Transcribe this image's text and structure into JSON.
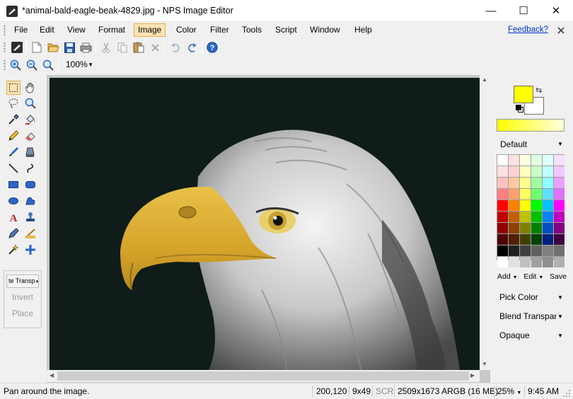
{
  "window": {
    "title": "*animal-bald-eagle-beak-4829.jpg - NPS Image Editor",
    "controls": {
      "minimize": "—",
      "maximize": "☐",
      "close": "✕"
    }
  },
  "menu": {
    "items": [
      "File",
      "Edit",
      "View",
      "Format",
      "Image",
      "Color",
      "Filter",
      "Tools",
      "Script",
      "Window",
      "Help"
    ],
    "active": "Image",
    "feedback": "Feedback?"
  },
  "toolbar": {
    "buttons": [
      "app-icon",
      "new-file-icon",
      "open-folder-icon",
      "save-icon",
      "print-icon",
      "cut-icon",
      "copy-icon",
      "paste-icon",
      "delete-icon",
      "undo-icon",
      "redo-icon",
      "help-icon"
    ],
    "zoom_buttons": [
      "zoom-in-icon",
      "zoom-out-icon",
      "zoom-actual-icon"
    ],
    "zoom_value": "100%"
  },
  "tools": {
    "icons": [
      "rectangle-select-icon",
      "pan-hand-icon",
      "lasso-select-icon",
      "zoom-tool-icon",
      "eyedropper-icon",
      "paint-bucket-icon",
      "pencil-icon",
      "eraser-icon",
      "brush-icon",
      "clone-stamp-icon",
      "line-icon",
      "curve-icon",
      "rectangle-shape-icon",
      "rounded-rectangle-icon",
      "ellipse-shape-icon",
      "freeform-shape-icon",
      "text-tool-icon",
      "stamp-icon",
      "pen-icon",
      "gradient-icon",
      "magic-wand-icon",
      "move-cross-icon"
    ],
    "selected": "rectangle-select-icon",
    "selection_mode": "te Transp",
    "invert_label": "Invert",
    "place_label": "Place"
  },
  "colors": {
    "primary": "#ffff00",
    "secondary": "#ffffff",
    "palette_name": "Default",
    "palette": [
      "#ffffff",
      "#ffe0e0",
      "#ffffe0",
      "#e0ffe0",
      "#e0ffff",
      "#f8e0ff",
      "#ffe0e0",
      "#ffd0d0",
      "#ffffc0",
      "#c8ffc8",
      "#c0ffff",
      "#f0c8ff",
      "#ffc0c0",
      "#ffc8a0",
      "#ffff90",
      "#a0ffa0",
      "#90ffff",
      "#e8a0ff",
      "#ff8080",
      "#ffa070",
      "#ffff60",
      "#70ff70",
      "#60e0ff",
      "#e070ff",
      "#ff0000",
      "#ff8000",
      "#ffff00",
      "#00ff00",
      "#00c0ff",
      "#ff00ff",
      "#c00000",
      "#c06000",
      "#c0c000",
      "#00c000",
      "#0080ff",
      "#c000c0",
      "#900000",
      "#904000",
      "#808000",
      "#008000",
      "#0050c0",
      "#800080",
      "#500000",
      "#502000",
      "#404000",
      "#004000",
      "#002080",
      "#400040",
      "#000000",
      "#202020",
      "#404040",
      "#606060",
      "#808080",
      "#707070",
      "#ffffff",
      "#e0e0e0",
      "#c0c0c0",
      "#a0a0a0",
      "#909090",
      "#b0b0b0"
    ],
    "palette_actions": {
      "add": "Add",
      "edit": "Edit",
      "save": "Save"
    },
    "pick_color": "Pick Color",
    "blend_mode": "Blend Transparency",
    "opacity_mode": "Opaque"
  },
  "status": {
    "message": "Pan around the image.",
    "cursor_position": "200,120",
    "selection_size": "9x49",
    "scr": "SCR",
    "image_info": "2509x1673 ARGB (16 MB)",
    "zoom": "25%",
    "time": "9:45 AM"
  }
}
